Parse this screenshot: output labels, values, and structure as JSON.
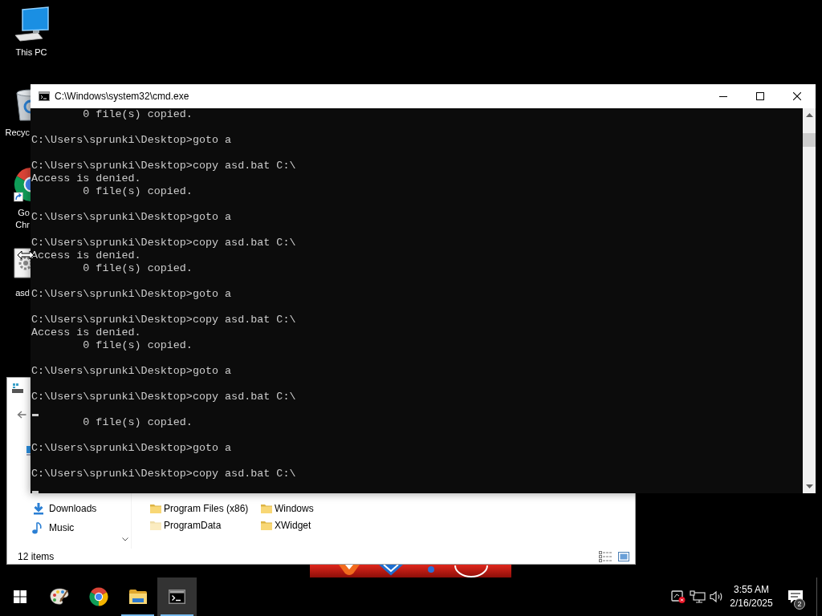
{
  "desktop": {
    "icons": [
      {
        "kind": "computer",
        "label_lines": [
          "This PC"
        ]
      },
      {
        "kind": "recycle-bin",
        "label_lines": [
          "Recyc"
        ]
      },
      {
        "kind": "chrome-shortcut",
        "label_lines": [
          "Go",
          "Chr"
        ]
      },
      {
        "kind": "batch-file",
        "label_lines": [
          "asd"
        ]
      }
    ]
  },
  "explorer_window": {
    "navigation_pane": [
      {
        "kind": "downloads",
        "label": "Downloads"
      },
      {
        "kind": "music",
        "label": "Music"
      }
    ],
    "folders": [
      {
        "name": "Program Files (x86)",
        "hidden": false
      },
      {
        "name": "ProgramData",
        "hidden": true
      },
      {
        "name": "Windows",
        "hidden": false
      },
      {
        "name": "XWidget",
        "hidden": false
      }
    ],
    "status_bar": {
      "item_count": "12 items"
    }
  },
  "console_window": {
    "title": "C:\\Windows\\system32\\cmd.exe",
    "lines": [
      {
        "kind": "output",
        "text": "        0 file(s) copied."
      },
      {
        "kind": "blank"
      },
      {
        "kind": "output",
        "text": "C:\\Users\\sprunki\\Desktop>goto a"
      },
      {
        "kind": "blank"
      },
      {
        "kind": "output",
        "text": "C:\\Users\\sprunki\\Desktop>copy asd.bat C:\\"
      },
      {
        "kind": "output",
        "text": "Access is denied."
      },
      {
        "kind": "output",
        "text": "        0 file(s) copied."
      },
      {
        "kind": "blank"
      },
      {
        "kind": "output",
        "text": "C:\\Users\\sprunki\\Desktop>goto a"
      },
      {
        "kind": "blank"
      },
      {
        "kind": "output",
        "text": "C:\\Users\\sprunki\\Desktop>copy asd.bat C:\\"
      },
      {
        "kind": "output",
        "text": "Access is denied."
      },
      {
        "kind": "output",
        "text": "        0 file(s) copied."
      },
      {
        "kind": "blank"
      },
      {
        "kind": "output",
        "text": "C:\\Users\\sprunki\\Desktop>goto a"
      },
      {
        "kind": "blank"
      },
      {
        "kind": "output",
        "text": "C:\\Users\\sprunki\\Desktop>copy asd.bat C:\\"
      },
      {
        "kind": "output",
        "text": "Access is denied."
      },
      {
        "kind": "output",
        "text": "        0 file(s) copied."
      },
      {
        "kind": "blank"
      },
      {
        "kind": "output",
        "text": "C:\\Users\\sprunki\\Desktop>goto a"
      },
      {
        "kind": "blank"
      },
      {
        "kind": "output",
        "text": "C:\\Users\\sprunki\\Desktop>copy asd.bat C:\\"
      },
      {
        "kind": "cursor"
      },
      {
        "kind": "output",
        "text": "        0 file(s) copied."
      },
      {
        "kind": "blank"
      },
      {
        "kind": "output",
        "text": "C:\\Users\\sprunki\\Desktop>goto a"
      },
      {
        "kind": "blank"
      },
      {
        "kind": "output",
        "text": "C:\\Users\\sprunki\\Desktop>copy asd.bat C:\\"
      },
      {
        "kind": "cursor"
      }
    ]
  },
  "taskbar": {
    "apps": [
      {
        "kind": "paint",
        "running": false,
        "selected": false
      },
      {
        "kind": "chrome",
        "running": false,
        "selected": false
      },
      {
        "kind": "file-explorer",
        "running": true,
        "selected": false
      },
      {
        "kind": "command-prompt",
        "running": true,
        "selected": true
      }
    ],
    "clock": {
      "time": "3:55 AM",
      "date": "2/16/2025"
    },
    "notifications": {
      "count": "2"
    }
  }
}
